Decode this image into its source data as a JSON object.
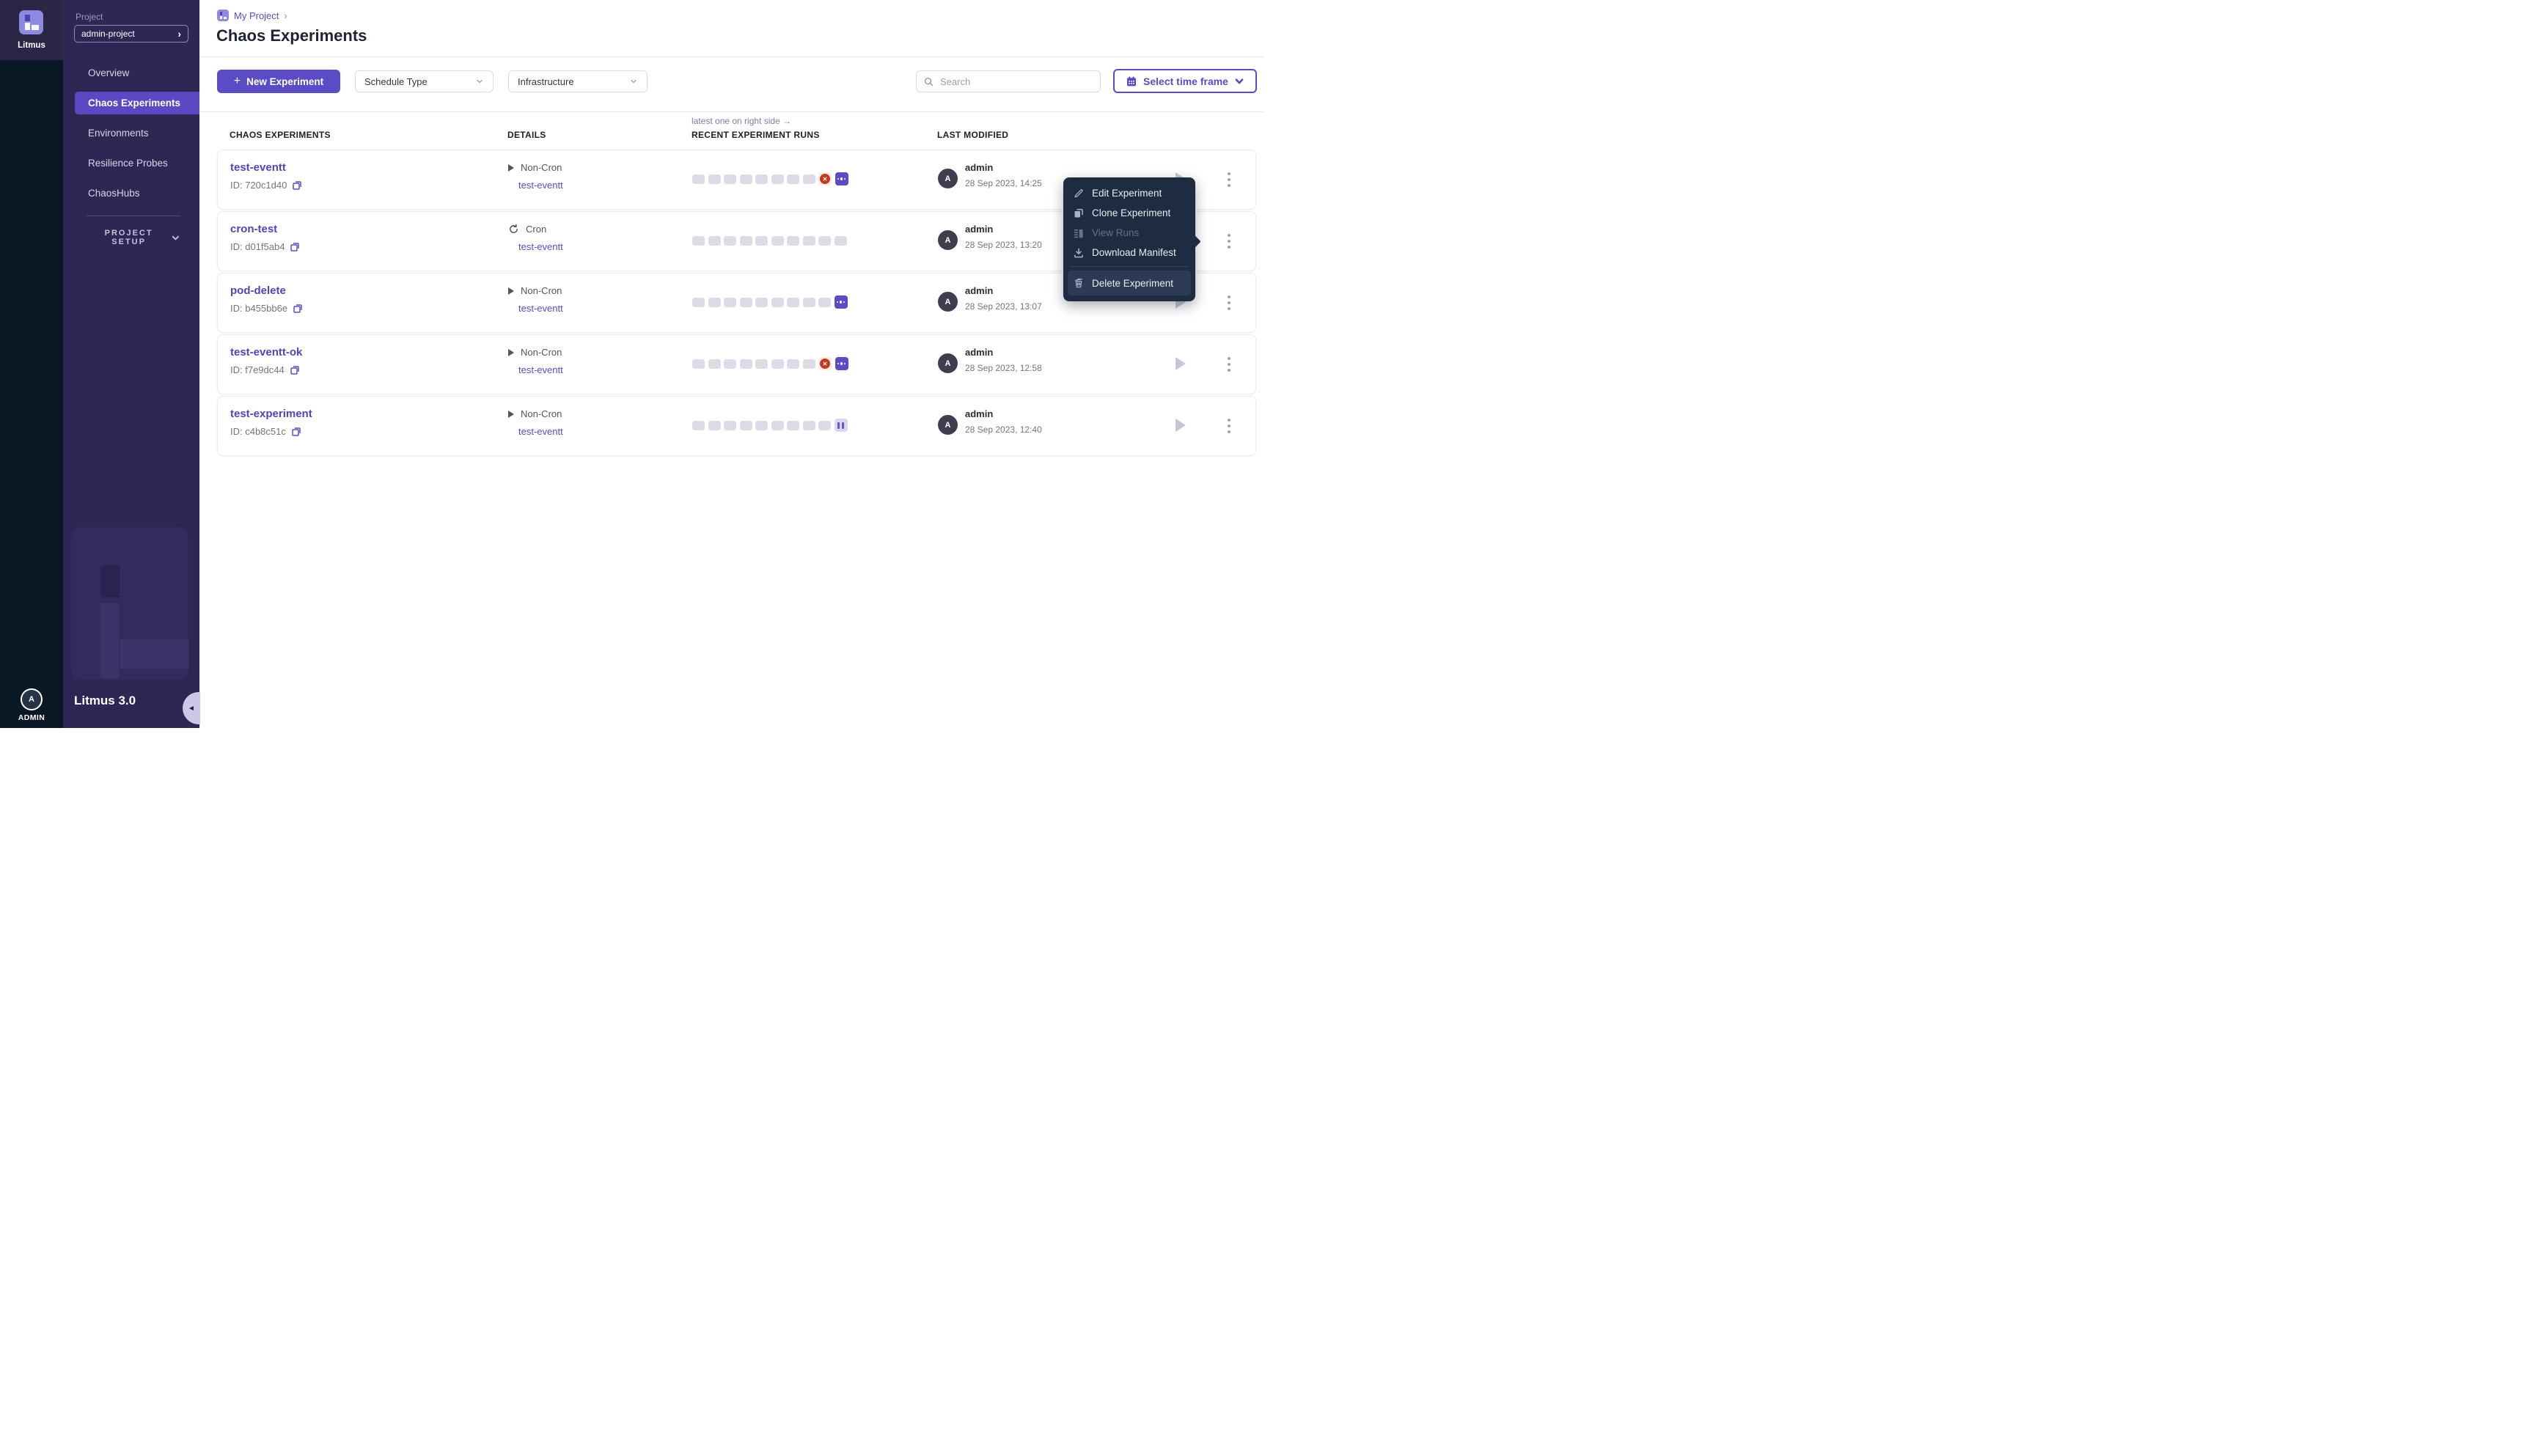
{
  "sidebar": {
    "logo_text": "Litmus",
    "project_label": "Project",
    "project_name": "admin-project",
    "nav": [
      {
        "label": "Overview",
        "active": false
      },
      {
        "label": "Chaos Experiments",
        "active": true
      },
      {
        "label": "Environments",
        "active": false
      },
      {
        "label": "Resilience Probes",
        "active": false
      },
      {
        "label": "ChaosHubs",
        "active": false
      }
    ],
    "project_setup_label": "PROJECT SETUP",
    "version": "Litmus 3.0",
    "user_label": "ADMIN",
    "user_avatar_letter": "A"
  },
  "header": {
    "breadcrumb_project": "My Project",
    "breadcrumb_chevron": "›",
    "title": "Chaos Experiments"
  },
  "toolbar": {
    "new_experiment_plus": "+",
    "new_experiment_label": "New Experiment",
    "schedule_filter_label": "Schedule Type",
    "infrastructure_filter_label": "Infrastructure",
    "search_placeholder": "Search",
    "time_frame_label": "Select time frame"
  },
  "table": {
    "columns": [
      "CHAOS EXPERIMENTS",
      "DETAILS",
      "RECENT EXPERIMENT RUNS",
      "LAST MODIFIED"
    ],
    "runs_note": "latest one on right side →",
    "rows": [
      {
        "name": "test-eventt",
        "id_label": "ID: 720c1d40",
        "schedule_type": "Non-Cron",
        "infrastructure": "test-eventt",
        "runs": [
          "empty",
          "empty",
          "empty",
          "empty",
          "empty",
          "empty",
          "empty",
          "empty",
          "failed",
          "more"
        ],
        "modified_by": "admin",
        "modified_at": "28 Sep 2023, 14:25"
      },
      {
        "name": "cron-test",
        "id_label": "ID: d01f5ab4",
        "schedule_type": "Cron",
        "infrastructure": "test-eventt",
        "runs": [
          "empty",
          "empty",
          "empty",
          "empty",
          "empty",
          "empty",
          "empty",
          "empty",
          "empty",
          "empty"
        ],
        "modified_by": "admin",
        "modified_at": "28 Sep 2023, 13:20"
      },
      {
        "name": "pod-delete",
        "id_label": "ID: b455bb6e",
        "schedule_type": "Non-Cron",
        "infrastructure": "test-eventt",
        "runs": [
          "empty",
          "empty",
          "empty",
          "empty",
          "empty",
          "empty",
          "empty",
          "empty",
          "empty",
          "more"
        ],
        "modified_by": "admin",
        "modified_at": "28 Sep 2023, 13:07"
      },
      {
        "name": "test-eventt-ok",
        "id_label": "ID: f7e9dc44",
        "schedule_type": "Non-Cron",
        "infrastructure": "test-eventt",
        "runs": [
          "empty",
          "empty",
          "empty",
          "empty",
          "empty",
          "empty",
          "empty",
          "empty",
          "failed",
          "more"
        ],
        "modified_by": "admin",
        "modified_at": "28 Sep 2023, 12:58"
      },
      {
        "name": "test-experiment",
        "id_label": "ID: c4b8c51c",
        "schedule_type": "Non-Cron",
        "infrastructure": "test-eventt",
        "runs": [
          "empty",
          "empty",
          "empty",
          "empty",
          "empty",
          "empty",
          "empty",
          "empty",
          "empty",
          "paused"
        ],
        "modified_by": "admin",
        "modified_at": "28 Sep 2023, 12:40"
      }
    ]
  },
  "context_menu": {
    "items": [
      {
        "label": "Edit Experiment",
        "icon": "pencil-icon",
        "disabled": false,
        "danger": false
      },
      {
        "label": "Clone Experiment",
        "icon": "clone-icon",
        "disabled": false,
        "danger": false
      },
      {
        "label": "View Runs",
        "icon": "runs-icon",
        "disabled": true,
        "danger": false
      },
      {
        "label": "Download Manifest",
        "icon": "download-icon",
        "disabled": false,
        "danger": false
      },
      {
        "label": "Delete Experiment",
        "icon": "trash-icon",
        "disabled": false,
        "danger": true
      }
    ]
  },
  "colors": {
    "accent_purple": "#5B4BC4",
    "sidebar_purple": "#2E2754",
    "active_nav": "#5B48C2",
    "rail_navy": "#0A1724",
    "menu_navy": "#1E2B40",
    "failed_red": "#C23A1D",
    "empty_run_gray": "#DBDCE6",
    "paused_lavender": "#D9D6F4"
  }
}
